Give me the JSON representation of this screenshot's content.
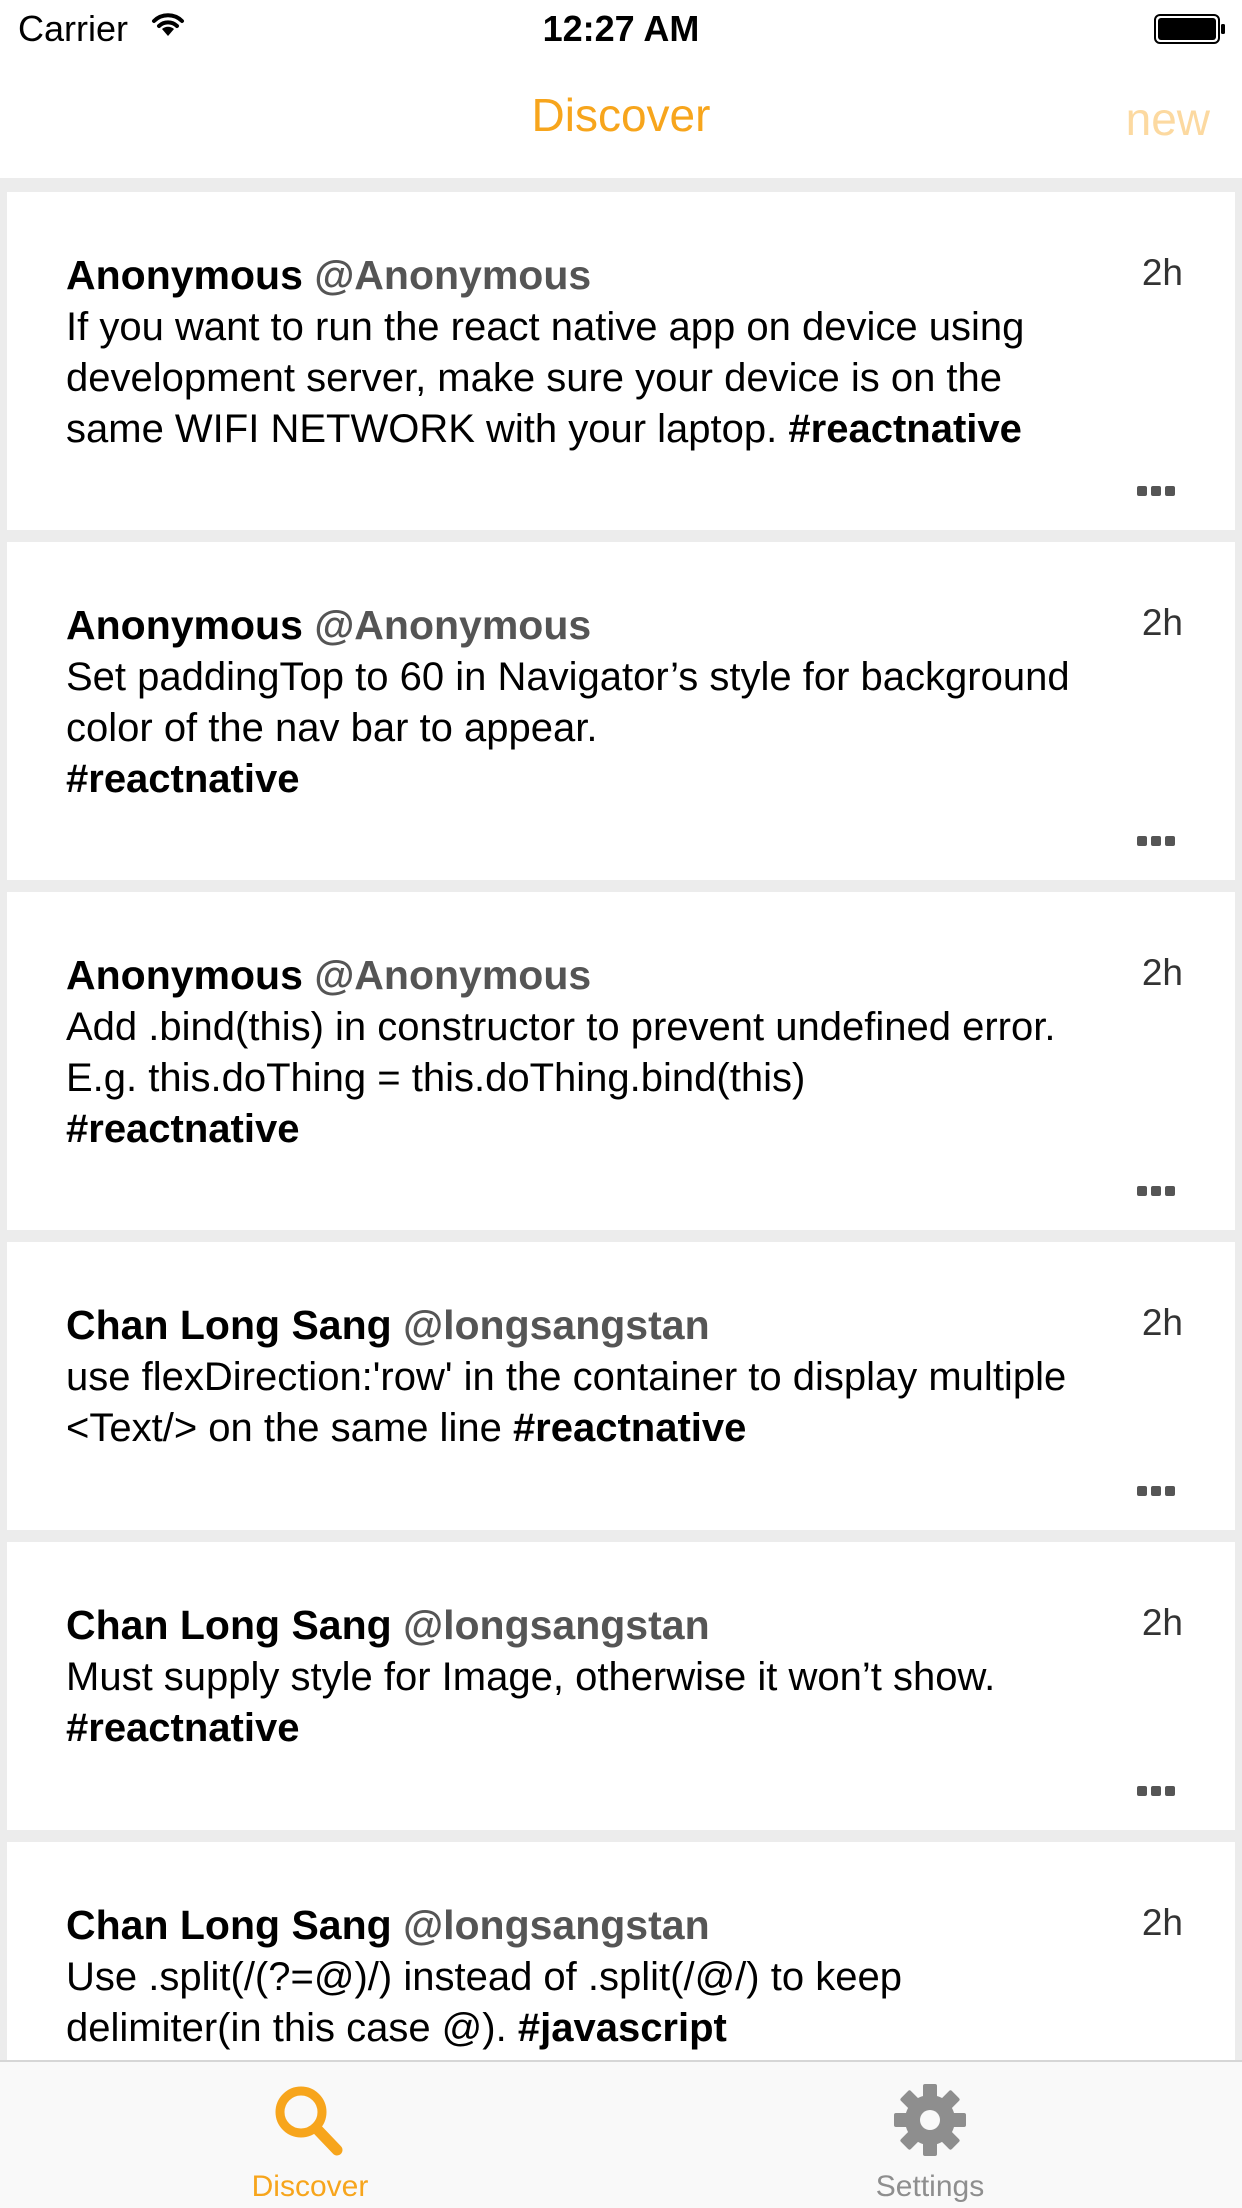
{
  "status_bar": {
    "carrier": "Carrier",
    "time": "12:27 AM"
  },
  "nav": {
    "title": "Discover",
    "new_label": "new"
  },
  "posts": [
    {
      "name": "Anonymous",
      "handle": "@Anonymous",
      "time": "2h",
      "lines": [
        [
          {
            "t": "If you want to run the react native app on device using"
          }
        ],
        [
          {
            "t": "development server, make sure your device is on the"
          }
        ],
        [
          {
            "t": "same WIFI NETWORK with your laptop. "
          },
          {
            "t": "#reactnative",
            "tag": true
          }
        ]
      ]
    },
    {
      "name": "Anonymous",
      "handle": "@Anonymous",
      "time": "2h",
      "lines": [
        [
          {
            "t": "Set paddingTop to 60 in Navigator’s style for background"
          }
        ],
        [
          {
            "t": "color of the nav bar to appear."
          }
        ],
        [
          {
            "t": "#reactnative",
            "tag": true
          }
        ]
      ]
    },
    {
      "name": "Anonymous",
      "handle": "@Anonymous",
      "time": "2h",
      "lines": [
        [
          {
            "t": "Add .bind(this) in constructor to prevent undefined error."
          }
        ],
        [
          {
            "t": "E.g. this.doThing = this.doThing.bind(this)"
          }
        ],
        [
          {
            "t": "#reactnative",
            "tag": true
          }
        ]
      ]
    },
    {
      "name": "Chan Long Sang",
      "handle": "@longsangstan",
      "time": "2h",
      "lines": [
        [
          {
            "t": "use flexDirection:'row' in the container to display multiple"
          }
        ],
        [
          {
            "t": "<Text/> on the same line "
          },
          {
            "t": "#reactnative",
            "tag": true
          }
        ]
      ]
    },
    {
      "name": "Chan Long Sang",
      "handle": "@longsangstan",
      "time": "2h",
      "lines": [
        [
          {
            "t": "Must supply style for Image, otherwise it won’t show."
          }
        ],
        [
          {
            "t": "#reactnative",
            "tag": true
          }
        ]
      ]
    },
    {
      "name": "Chan Long Sang",
      "handle": "@longsangstan",
      "time": "2h",
      "lines": [
        [
          {
            "t": "Use .split(/(?=@)/) instead of .split(/@/) to keep"
          }
        ],
        [
          {
            "t": "delimiter(in this case @). "
          },
          {
            "t": "#javascript",
            "tag": true
          }
        ]
      ]
    }
  ],
  "tabs": [
    {
      "label": "Discover",
      "icon": "search-icon",
      "active": true
    },
    {
      "label": "Settings",
      "icon": "gear-icon",
      "active": false
    }
  ],
  "colors": {
    "accent": "#f7a51c",
    "accent_light": "#fcd9a0",
    "inactive": "#8e8e8e"
  }
}
